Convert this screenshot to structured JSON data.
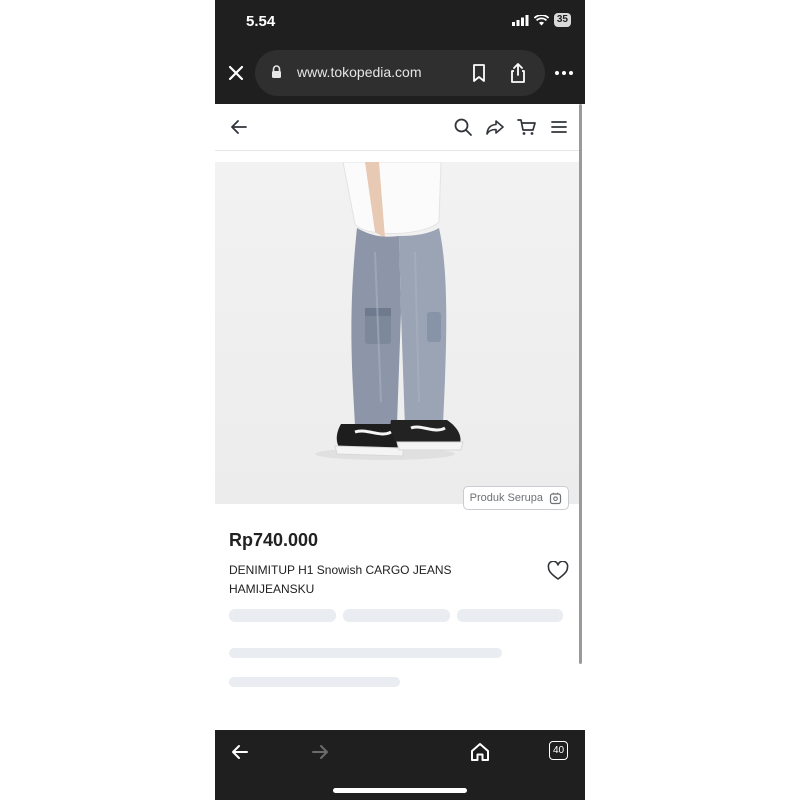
{
  "status": {
    "time": "5.54",
    "battery": "35"
  },
  "browser": {
    "url": "www.tokopedia.com",
    "tab_count": "40"
  },
  "product": {
    "price": "Rp740.000",
    "title": "DENIMITUP H1 Snowish CARGO JEANS HAMIJEANSKU",
    "similar_label": "Produk Serupa"
  },
  "icons": {
    "close": "close-icon",
    "lock": "lock-icon",
    "bookmark": "bookmark-icon",
    "share": "share-icon",
    "more": "more-icon",
    "back": "arrow-left-icon",
    "search": "search-icon",
    "share_product": "share-arrow-icon",
    "cart": "cart-icon",
    "menu": "hamburger-icon",
    "wishlist": "heart-icon",
    "nav_back": "arrow-left-icon",
    "nav_forward": "arrow-right-icon",
    "home": "home-icon",
    "tabs": "tabs-icon"
  },
  "colors": {
    "browser_chrome": "#1f1f1f",
    "skeleton": "#e9ecf1",
    "text": "#212121"
  }
}
